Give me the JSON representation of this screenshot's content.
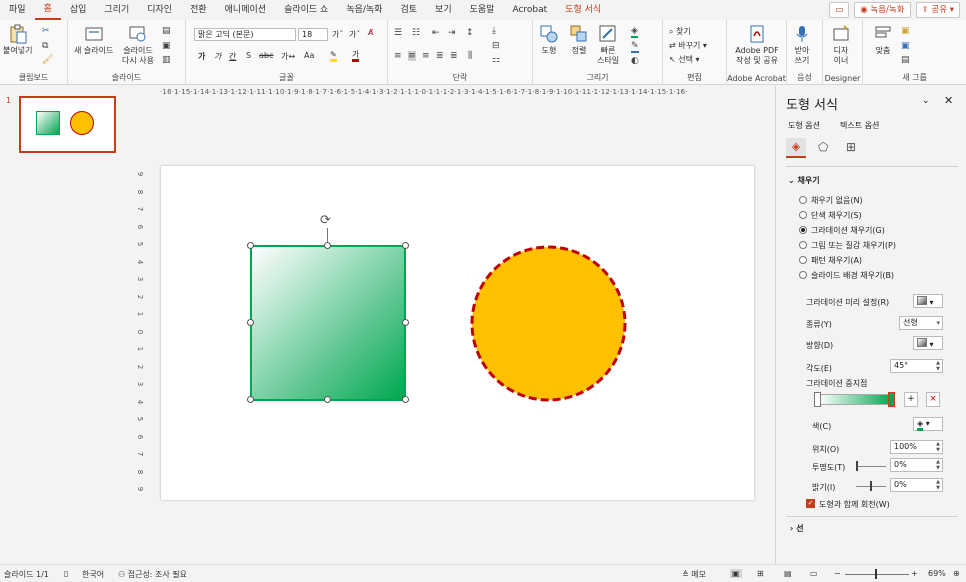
{
  "menu": {
    "tabs": [
      "파일",
      "홈",
      "삽입",
      "그리기",
      "디자인",
      "전환",
      "애니메이션",
      "슬라이드 쇼",
      "녹음/녹화",
      "검토",
      "보기",
      "도움말",
      "Acrobat",
      "도형 서식"
    ],
    "active_index": 1,
    "comment_icon": "comment-icon",
    "record_label": "녹음/녹화",
    "share_label": "공유"
  },
  "ribbon": {
    "clipboard": {
      "paste": "붙여넣기",
      "label": "클립보드"
    },
    "slides": {
      "new": "새 슬라이드",
      "reuse_1": "슬라이드",
      "reuse_2": "다시 사용",
      "label": "슬라이드"
    },
    "font": {
      "name": "맑은 고딕 (본문)",
      "size": "18",
      "grow": "가ˆ",
      "shrink": "가ˇ",
      "b": "가",
      "i": "가",
      "u": "간",
      "s": "S",
      "abc": "abc",
      "spacing": "가↔",
      "case": "Aa",
      "color_a": "가",
      "label": "글꼴"
    },
    "paragraph": {
      "label": "단락"
    },
    "drawing": {
      "shape": "도형",
      "arrange": "정렬",
      "quick_1": "빠른",
      "quick_2": "스타일",
      "label": "그리기"
    },
    "editing": {
      "find": "찾기",
      "replace": "바꾸기",
      "select": "선택",
      "label": "편집"
    },
    "acrobat": {
      "line1": "Adobe PDF",
      "line2": "작성 및 공유",
      "label": "Adobe Acrobat"
    },
    "voice": {
      "line1": "받아",
      "line2": "쓰기",
      "label": "음성"
    },
    "designer": {
      "line1": "디자",
      "line2": "이너",
      "label": "Designer"
    },
    "newgroup": {
      "fit": "맞춤",
      "label": "새 그룹"
    }
  },
  "thumbnail": {
    "number": "1"
  },
  "ruler": {
    "h": "·16·1·15·1·14·1·13·1·12·1·11·1·10·1·9·1·8·1·7·1·6·1·5·1·4·1·3·1·2·1·1·1·0·1·1·1·2·1·3·1·4·1·5·1·6·1·7·1·8·1·9·1·10·1·11·1·12·1·13·1·14·1·15·1·16·",
    "v": [
      "9",
      "8",
      "7",
      "6",
      "5",
      "4",
      "3",
      "2",
      "1",
      "0",
      "1",
      "2",
      "3",
      "4",
      "5",
      "6",
      "7",
      "8",
      "9"
    ]
  },
  "pane": {
    "title": "도형 서식",
    "tab_shape": "도형 옵션",
    "tab_text": "텍스트 옵션",
    "fill_section": "채우기",
    "options": [
      "채우기 없음(N)",
      "단색 채우기(S)",
      "그라데이션 채우기(G)",
      "그림 또는 질감 채우기(P)",
      "패턴 채우기(A)",
      "슬라이드 배경 채우기(B)"
    ],
    "selected_option": 2,
    "preset_label": "그라데이션 미리 설정(R)",
    "type_label": "종류(Y)",
    "type_value": "선형",
    "direction_label": "방향(D)",
    "angle_label": "각도(E)",
    "angle_value": "45°",
    "stops_label": "그라데이션 중지점",
    "color_label": "색(C)",
    "position_label": "위치(O)",
    "position_value": "100%",
    "transparency_label": "투명도(T)",
    "transparency_value": "0%",
    "brightness_label": "밝기(I)",
    "brightness_value": "0%",
    "rotate_label": "도형과 함께 회전(W)",
    "line_section": "선"
  },
  "status": {
    "slide": "슬라이드 1/1",
    "lang": "한국어",
    "access": "접근성: 조사 필요",
    "notes": "메모",
    "zoom": "69%"
  },
  "colors": {
    "accent": "#c43e1c",
    "green": "#00a651",
    "circle_fill": "#ffc000",
    "circle_stroke": "#c00000"
  }
}
